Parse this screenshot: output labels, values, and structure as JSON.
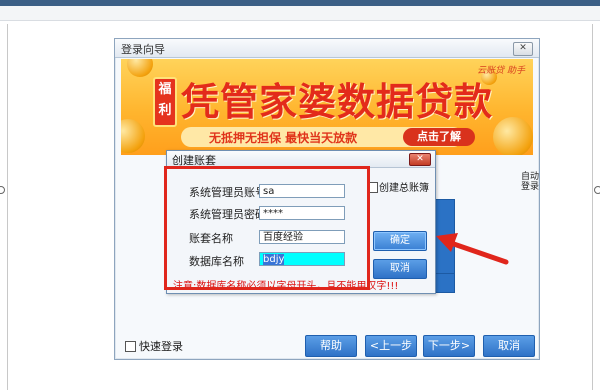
{
  "wizard": {
    "title": "登录向导",
    "close_label": "✕",
    "banner": {
      "badge_top": "福",
      "badge_bottom": "利",
      "headline": "凭管家婆数据贷款",
      "slogan": "无抵押无担保  最快当天放款",
      "cta": "点击了解",
      "brand": "云账贷 助手"
    },
    "right_text_1": "自动",
    "right_text_2": "登录",
    "quick_login": "快速登录",
    "buttons": {
      "help": "帮助",
      "prev": "<上一步",
      "next": "下一步>",
      "cancel": "取消"
    }
  },
  "dialog": {
    "title": "创建账套",
    "close_label": "✕",
    "fields": [
      {
        "label": "系统管理员账号",
        "value": "sa"
      },
      {
        "label": "系统管理员密码",
        "value": "****"
      },
      {
        "label": "账套名称",
        "value": "百度经验"
      },
      {
        "label": "数据库名称",
        "value": "bdjy"
      }
    ],
    "create_master_label": "创建总账簿",
    "ok": "确定",
    "cancel": "取消",
    "note": "注意:数据库名称必须以字母开头，且不能用汉字!!!"
  },
  "colors": {
    "annotation_red": "#e0261c",
    "button_blue": "#2f72c7",
    "highlight_cyan": "#00ffff"
  }
}
